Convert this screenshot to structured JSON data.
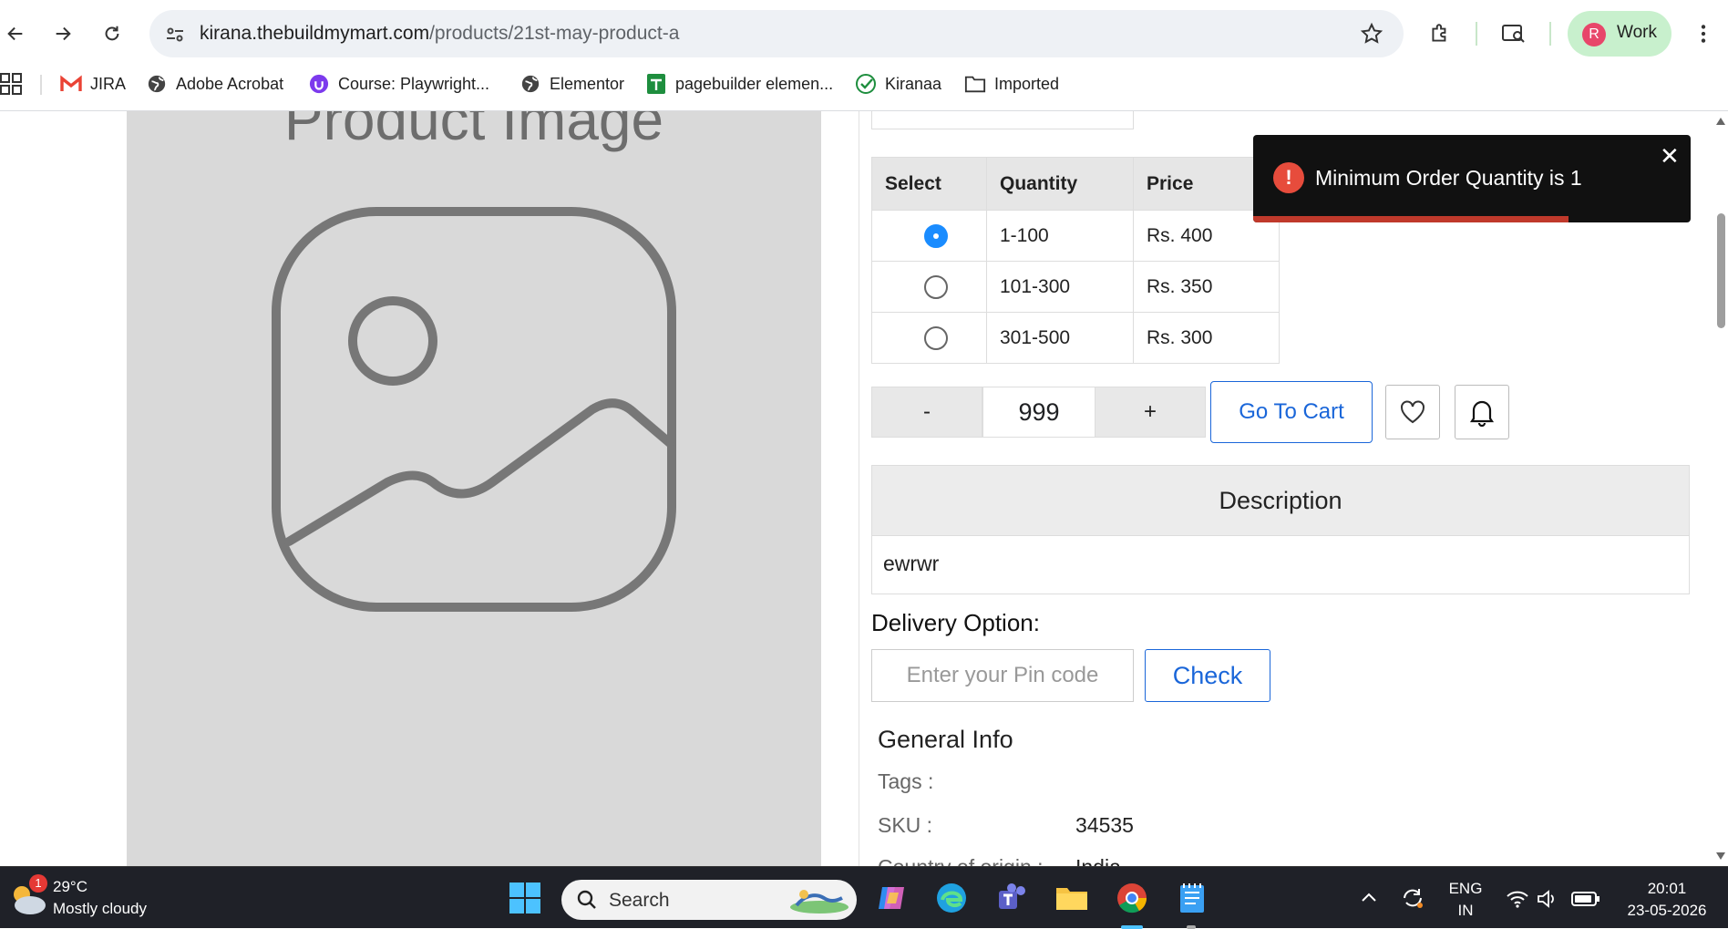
{
  "browser": {
    "url_host": "kirana.thebuildmymart.com",
    "url_path": "/products/21st-may-product-a",
    "profile_initial": "R",
    "profile_label": "Work",
    "bookmarks": [
      {
        "label": "JIRA",
        "icon": "gmail-icon"
      },
      {
        "label": "Adobe Acrobat",
        "icon": "globe-icon"
      },
      {
        "label": "Course: Playwright...",
        "icon": "course-icon"
      },
      {
        "label": "Elementor",
        "icon": "globe-icon"
      },
      {
        "label": "pagebuilder elemen...",
        "icon": "sheets-icon"
      },
      {
        "label": "Kiranaa",
        "icon": "check-circle-icon"
      },
      {
        "label": "Imported",
        "icon": "folder-icon"
      }
    ]
  },
  "product": {
    "image_caption": "Product Image",
    "price_table": {
      "headers": [
        "Select",
        "Quantity",
        "Price"
      ],
      "rows": [
        {
          "selected": true,
          "quantity": "1-100",
          "price": "Rs. 400"
        },
        {
          "selected": false,
          "quantity": "101-300",
          "price": "Rs. 350"
        },
        {
          "selected": false,
          "quantity": "301-500",
          "price": "Rs. 300"
        }
      ]
    },
    "quantity": {
      "minus": "-",
      "value": "999",
      "plus": "+"
    },
    "go_to_cart": "Go To Cart",
    "description_title": "Description",
    "description_text": "ewrwr",
    "delivery_label": "Delivery Option:",
    "pin_placeholder": "Enter your Pin code",
    "check_label": "Check",
    "general_info_title": "General Info",
    "general_info": [
      {
        "label": "Tags :",
        "value": ""
      },
      {
        "label": "SKU :",
        "value": "34535"
      },
      {
        "label": "Country of origin :",
        "value": "India"
      }
    ]
  },
  "toast": {
    "message": "Minimum Order Quantity is 1",
    "progress": 0.72
  },
  "taskbar": {
    "weather_temp": "29°C",
    "weather_desc": "Mostly cloudy",
    "weather_badge": "1",
    "search_label": "Search",
    "lang_top": "ENG",
    "lang_bottom": "IN",
    "time": "20:01",
    "date": "23-05-2026"
  }
}
